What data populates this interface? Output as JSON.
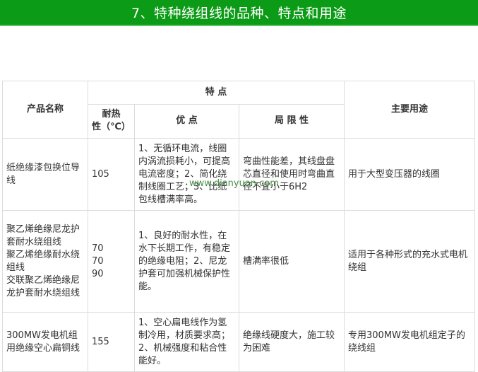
{
  "banner": {
    "title": "7、特种绕组线的品种、特点和用途"
  },
  "table": {
    "headers": {
      "product_name": "产品名称",
      "features": "特 点",
      "heat_resistance": "耐热\n性（℃）",
      "advantages": "优 点",
      "limitations": "局 限 性",
      "main_uses": "主要用途"
    },
    "rows": [
      {
        "name": "纸绝缘漆包换位导线",
        "heat": "105",
        "advantages": "1、无循环电流，线圈内涡流损耗小，可提高电流密度；2、简化绕制线圈工艺；3、比纸包线槽满率高。",
        "limitations": "弯曲性能差，其线盘盘芯直径和使用时弯曲直径不宜小于6H2",
        "uses": "用于大型变压器的线圈"
      },
      {
        "name": "聚乙烯绝缘尼龙护套耐水绕组线\n聚乙烯绝缘耐水绕组线\n交联聚乙烯绝缘尼龙护套耐水绕组线",
        "heat": "70\n70\n90",
        "advantages": "1、良好的耐水性，在水下长期工作，有稳定的绝缘电阻；2、尼龙护套可加强机械保护性能。",
        "limitations": "槽满率很低",
        "uses": "适用于各种形式的充水式电机绕组"
      },
      {
        "name": "300MW发电机组用绝缘空心扁铜线",
        "heat": "155",
        "advantages": "1、空心扁电线作为氢制冷用，材质要求高；2、机械强度和粘合性能好。",
        "limitations": "绝缘线硬度大，施工较为困难",
        "uses": "专用300MW发电机组定子的绕线组"
      }
    ]
  },
  "watermark": "www.dianyuan.com",
  "colors": {
    "banner": "#0c9b16",
    "border": "#dcdcdc",
    "text": "#333333"
  }
}
